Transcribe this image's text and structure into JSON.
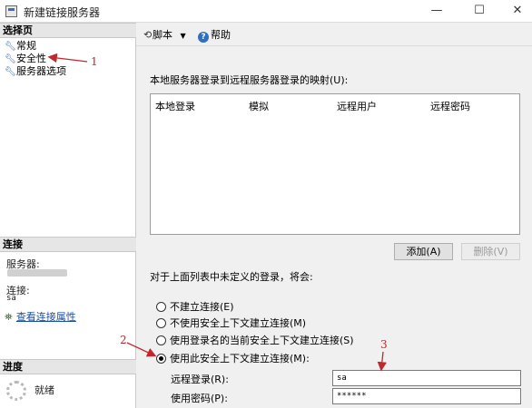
{
  "window": {
    "title": "新建链接服务器",
    "controls": [
      "—",
      "☐",
      "✕"
    ]
  },
  "left_panel": {
    "select_page_header": "选择页",
    "pages": [
      {
        "label": "常规"
      },
      {
        "label": "安全性"
      },
      {
        "label": "服务器选项"
      }
    ],
    "connection_header": "连接",
    "server_label": "服务器:",
    "connection_label": "连接:",
    "connection_value": "sa",
    "view_connection_link": "查看连接属性",
    "progress_header": "进度",
    "progress_status": "就绪"
  },
  "toolbar": {
    "script_label": "脚本",
    "help_label": "帮助"
  },
  "security": {
    "mapping_label": "本地服务器登录到远程服务器登录的映射(U):",
    "columns": [
      "本地登录",
      "模拟",
      "远程用户",
      "远程密码"
    ],
    "add_button": "添加(A)",
    "remove_button": "删除(V)",
    "undefined_label": "对于上面列表中未定义的登录，将会:",
    "options": [
      {
        "label": "不建立连接(E)",
        "checked": false
      },
      {
        "label": "不使用安全上下文建立连接(M)",
        "checked": false
      },
      {
        "label": "使用登录名的当前安全上下文建立连接(S)",
        "checked": false
      },
      {
        "label": "使用此安全上下文建立连接(M):",
        "checked": true
      }
    ],
    "remote_login_label": "远程登录(R):",
    "remote_login_value": "sa",
    "password_label": "使用密码(P):",
    "password_value": "******"
  },
  "annotations": [
    "1",
    "2",
    "3"
  ],
  "colors": {
    "annotation": "#c0282d",
    "link": "#1a4fa0",
    "section_header_bg": "#e6e6e6"
  }
}
